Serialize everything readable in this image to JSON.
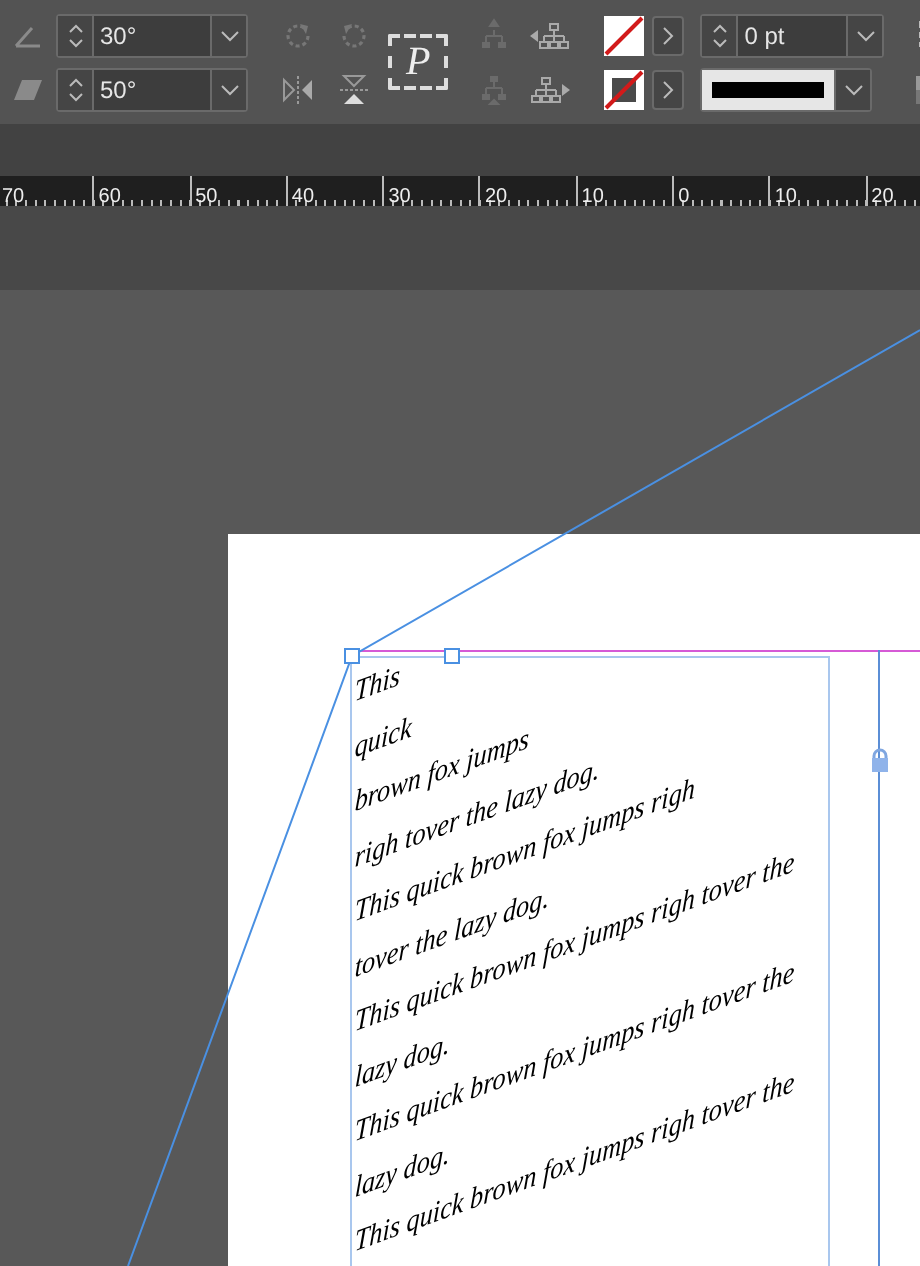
{
  "toolbar": {
    "rotation_angle": {
      "value": "30°"
    },
    "shear_angle": {
      "value": "50°"
    },
    "frame_glyph": "P",
    "stroke_weight": {
      "value": "0 pt"
    }
  },
  "ruler": {
    "labels": [
      "70",
      "60",
      "50",
      "40",
      "30",
      "20",
      "10",
      "0",
      "10",
      "20"
    ]
  },
  "document": {
    "text_lines": [
      "This",
      "quick",
      "brown fox jumps",
      "righ tover the lazy dog.",
      "This quick brown fox jumps righ",
      "tover the lazy dog.",
      "This quick brown fox jumps righ tover the",
      "lazy dog.",
      "This quick brown fox jumps righ tover the",
      "lazy dog.",
      "This quick brown fox jumps righ tover the"
    ]
  }
}
